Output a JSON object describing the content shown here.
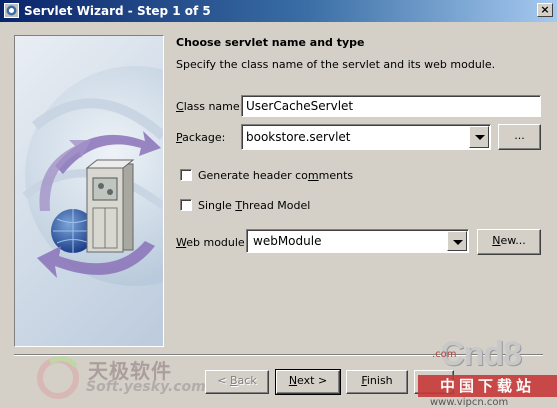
{
  "window": {
    "title": "Servlet Wizard - Step 1 of 5",
    "close_glyph": "×"
  },
  "header": {
    "heading": "Choose servlet name and type",
    "description": "Specify the class name of the servlet and its web module."
  },
  "form": {
    "class_name": {
      "label_mnemonic": "C",
      "label_rest": "lass name:",
      "value": "UserCacheServlet"
    },
    "package": {
      "label_mnemonic": "P",
      "label_rest": "ackage:",
      "value": "bookstore.servlet",
      "browse_label": "..."
    },
    "generate_header": {
      "label_before": "Generate header co",
      "label_mnemonic": "m",
      "label_after": "ments",
      "checked": false
    },
    "single_thread": {
      "label_before": "Single ",
      "label_mnemonic": "T",
      "label_after": "hread Model",
      "checked": false
    },
    "web_module": {
      "label_mnemonic": "W",
      "label_rest": "eb module:",
      "value": "webModule",
      "new_before": "",
      "new_mnemonic": "N",
      "new_after": "ew..."
    }
  },
  "buttons": {
    "back": {
      "prefix": "< ",
      "mnemonic": "B",
      "rest": "ack"
    },
    "next": {
      "mnemonic": "N",
      "rest": "ext >"
    },
    "finish": {
      "mnemonic": "F",
      "rest": "inish"
    }
  },
  "watermarks": {
    "left_cn": "天极软件",
    "left_url": "Soft.yesky.com",
    "right_com": ".com",
    "right_brand": "Cnd8",
    "right_cn": "中国下载站",
    "right_url": "www.vipcn.com"
  }
}
